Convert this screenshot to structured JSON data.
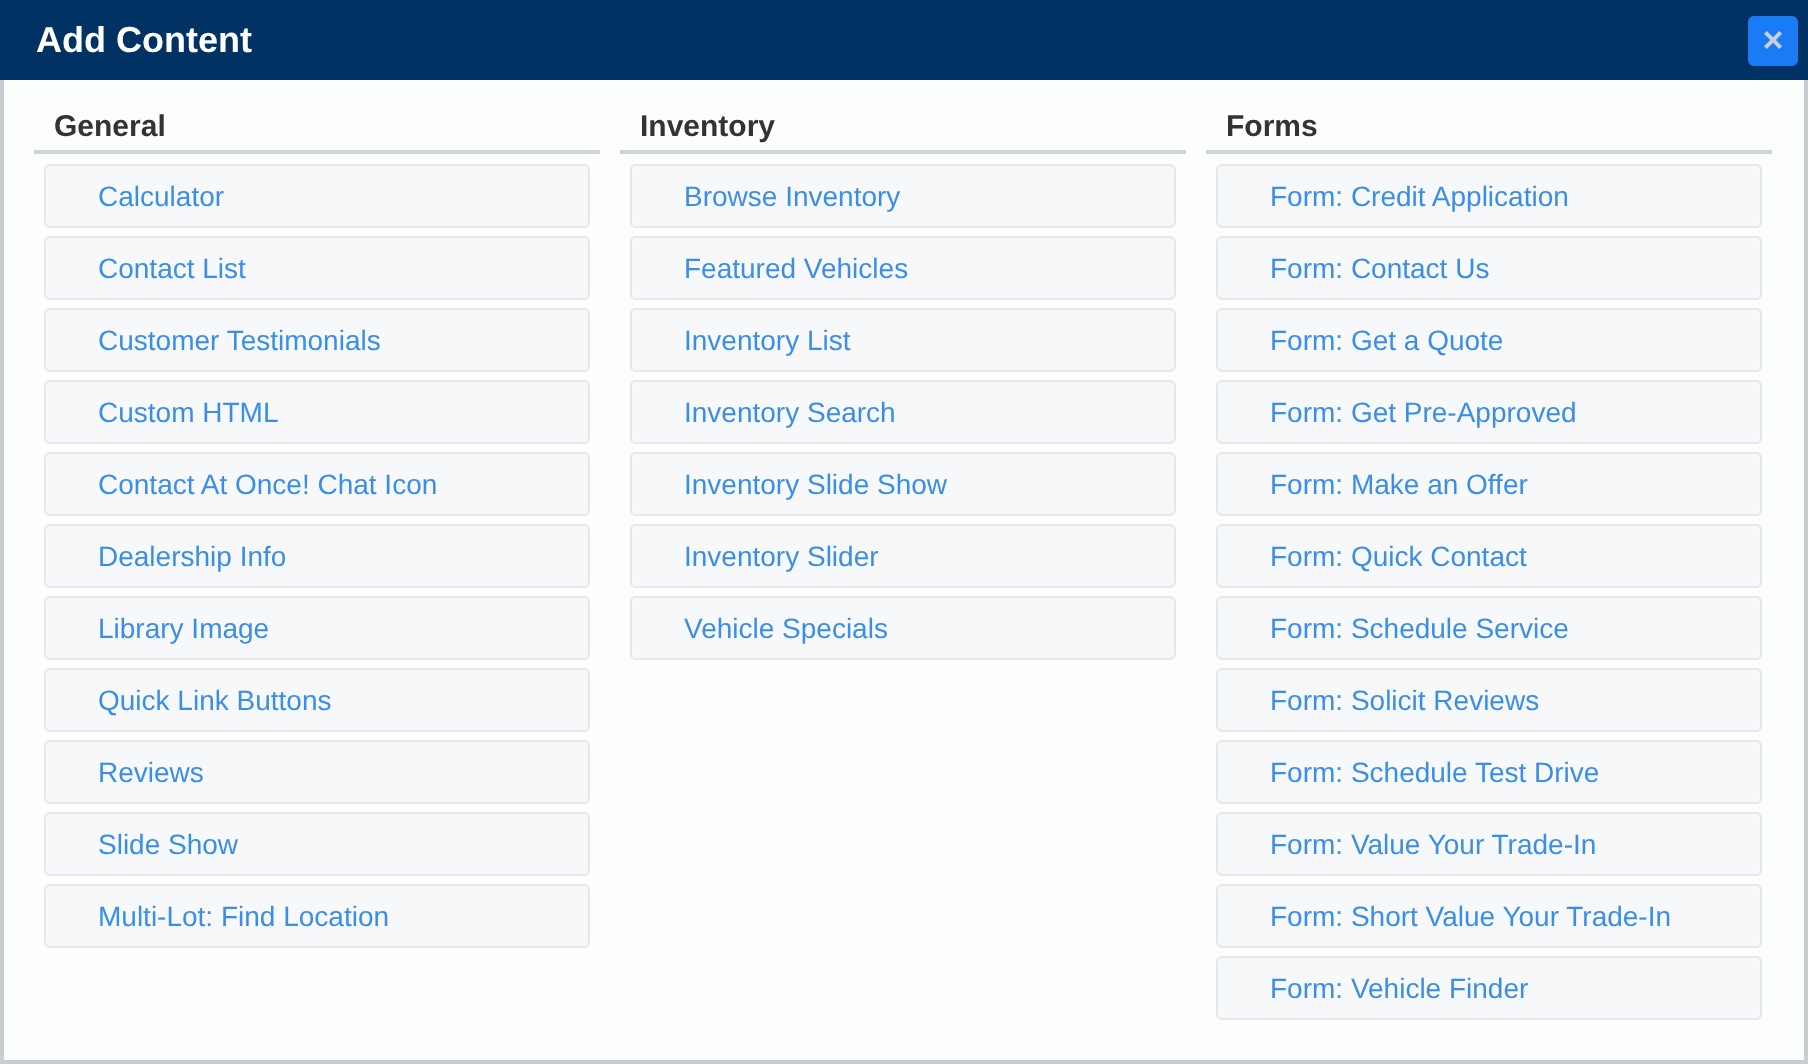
{
  "window": {
    "title": "Add Content",
    "close_label": "×"
  },
  "columns": [
    {
      "heading": "General",
      "items": [
        "Calculator",
        "Contact List",
        "Customer Testimonials",
        "Custom HTML",
        "Contact At Once! Chat Icon",
        "Dealership Info",
        "Library Image",
        "Quick Link Buttons",
        "Reviews",
        "Slide Show",
        "Multi-Lot: Find Location"
      ]
    },
    {
      "heading": "Inventory",
      "items": [
        "Browse Inventory",
        "Featured Vehicles",
        "Inventory List",
        "Inventory Search",
        "Inventory Slide Show",
        "Inventory Slider",
        "Vehicle Specials"
      ]
    },
    {
      "heading": "Forms",
      "items": [
        "Form: Credit Application",
        "Form: Contact Us",
        "Form: Get a Quote",
        "Form: Get Pre-Approved",
        "Form: Make an Offer",
        "Form: Quick Contact",
        "Form: Schedule Service",
        "Form: Solicit Reviews",
        "Form: Schedule Test Drive",
        "Form: Value Your Trade-In",
        "Form: Short Value Your Trade-In",
        "Form: Vehicle Finder"
      ]
    }
  ]
}
